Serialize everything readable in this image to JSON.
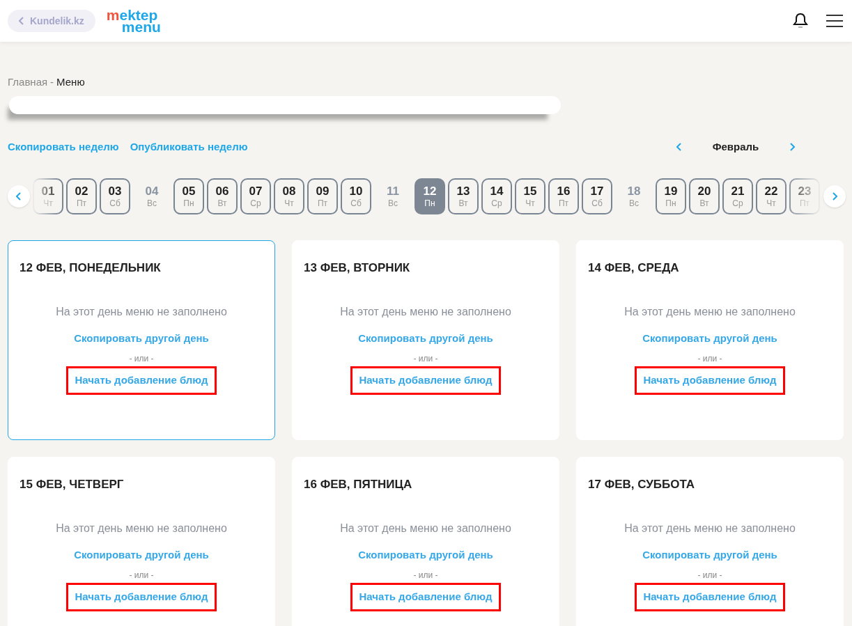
{
  "header": {
    "back_link": "Kundelik.kz",
    "logo": {
      "accent": "m",
      "line1": "ektep",
      "line2": "menu"
    }
  },
  "breadcrumb_separator": "-",
  "breadcrumb": [
    {
      "label": "Главная",
      "current": false
    },
    {
      "label": "Меню",
      "current": true
    }
  ],
  "actions": [
    "Скопировать неделю",
    "Опубликовать неделю"
  ],
  "month": "Февраль",
  "days": [
    {
      "day": "01",
      "weekday": "Чт",
      "kind": "workday",
      "selected": false
    },
    {
      "day": "02",
      "weekday": "Пт",
      "kind": "workday",
      "selected": false
    },
    {
      "day": "03",
      "weekday": "Сб",
      "kind": "workday",
      "selected": false
    },
    {
      "day": "04",
      "weekday": "Вс",
      "kind": "holiday",
      "selected": false
    },
    {
      "day": "05",
      "weekday": "Пн",
      "kind": "workday",
      "selected": false
    },
    {
      "day": "06",
      "weekday": "Вт",
      "kind": "workday",
      "selected": false
    },
    {
      "day": "07",
      "weekday": "Ср",
      "kind": "workday",
      "selected": false
    },
    {
      "day": "08",
      "weekday": "Чт",
      "kind": "workday",
      "selected": false
    },
    {
      "day": "09",
      "weekday": "Пт",
      "kind": "workday",
      "selected": false
    },
    {
      "day": "10",
      "weekday": "Сб",
      "kind": "workday",
      "selected": false
    },
    {
      "day": "11",
      "weekday": "Вс",
      "kind": "holiday",
      "selected": false
    },
    {
      "day": "12",
      "weekday": "Пн",
      "kind": "workday",
      "selected": true
    },
    {
      "day": "13",
      "weekday": "Вт",
      "kind": "workday",
      "selected": false
    },
    {
      "day": "14",
      "weekday": "Ср",
      "kind": "workday",
      "selected": false
    },
    {
      "day": "15",
      "weekday": "Чт",
      "kind": "workday",
      "selected": false
    },
    {
      "day": "16",
      "weekday": "Пт",
      "kind": "workday",
      "selected": false
    },
    {
      "day": "17",
      "weekday": "Сб",
      "kind": "workday",
      "selected": false
    },
    {
      "day": "18",
      "weekday": "Вс",
      "kind": "holiday",
      "selected": false
    },
    {
      "day": "19",
      "weekday": "Пн",
      "kind": "workday",
      "selected": false
    },
    {
      "day": "20",
      "weekday": "Вт",
      "kind": "workday",
      "selected": false
    },
    {
      "day": "21",
      "weekday": "Ср",
      "kind": "workday",
      "selected": false
    },
    {
      "day": "22",
      "weekday": "Чт",
      "kind": "workday",
      "selected": false
    },
    {
      "day": "23",
      "weekday": "Пт",
      "kind": "workday",
      "selected": false
    }
  ],
  "cards": [
    {
      "title": "12 ФЕВ, ПОНЕДЕЛЬНИК",
      "selected": true,
      "message": "На этот день меню не заполнено",
      "copy_link": "Скопировать другой день",
      "separator": "- или -",
      "start_link": "Начать добавление блюд",
      "highlighted": true
    },
    {
      "title": "13 ФЕВ, ВТОРНИК",
      "selected": false,
      "message": "На этот день меню не заполнено",
      "copy_link": "Скопировать другой день",
      "separator": "- или -",
      "start_link": "Начать добавление блюд",
      "highlighted": true
    },
    {
      "title": "14 ФЕВ, СРЕДА",
      "selected": false,
      "message": "На этот день меню не заполнено",
      "copy_link": "Скопировать другой день",
      "separator": "- или -",
      "start_link": "Начать добавление блюд",
      "highlighted": true
    },
    {
      "title": "15 ФЕВ, ЧЕТВЕРГ",
      "selected": false,
      "message": "На этот день меню не заполнено",
      "copy_link": "Скопировать другой день",
      "separator": "- или -",
      "start_link": "Начать добавление блюд",
      "highlighted": true
    },
    {
      "title": "16 ФЕВ, ПЯТНИЦА",
      "selected": false,
      "message": "На этот день меню не заполнено",
      "copy_link": "Скопировать другой день",
      "separator": "- или -",
      "start_link": "Начать добавление блюд",
      "highlighted": true
    },
    {
      "title": "17 ФЕВ, СУББОТА",
      "selected": false,
      "message": "На этот день меню не заполнено",
      "copy_link": "Скопировать другой день",
      "separator": "- или -",
      "start_link": "Начать добавление блюд",
      "highlighted": true
    }
  ]
}
